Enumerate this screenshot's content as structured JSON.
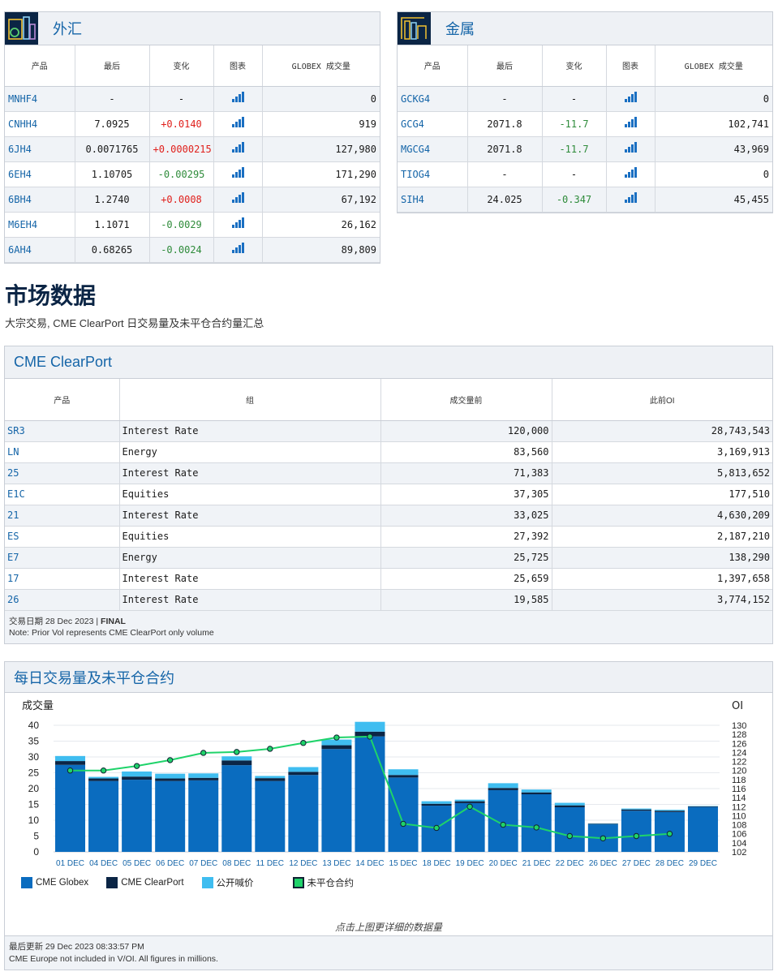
{
  "fx": {
    "title": "外汇",
    "columns": [
      "产品",
      "最后",
      "变化",
      "图表",
      "GLOBEX 成交量"
    ],
    "rows": [
      {
        "symbol": "MNHF4",
        "last": "-",
        "change": "-",
        "dir": "none",
        "volume": "0"
      },
      {
        "symbol": "CNHH4",
        "last": "7.0925",
        "change": "+0.0140",
        "dir": "up",
        "volume": "919"
      },
      {
        "symbol": "6JH4",
        "last": "0.0071765",
        "change": "+0.0000215",
        "dir": "up",
        "volume": "127,980"
      },
      {
        "symbol": "6EH4",
        "last": "1.10705",
        "change": "-0.00295",
        "dir": "down",
        "volume": "171,290"
      },
      {
        "symbol": "6BH4",
        "last": "1.2740",
        "change": "+0.0008",
        "dir": "up",
        "volume": "67,192"
      },
      {
        "symbol": "M6EH4",
        "last": "1.1071",
        "change": "-0.0029",
        "dir": "down",
        "volume": "26,162"
      },
      {
        "symbol": "6AH4",
        "last": "0.68265",
        "change": "-0.0024",
        "dir": "down",
        "volume": "89,809"
      }
    ]
  },
  "metals": {
    "title": "金属",
    "columns": [
      "产品",
      "最后",
      "变化",
      "图表",
      "GLOBEX 成交量"
    ],
    "rows": [
      {
        "symbol": "GCKG4",
        "last": "-",
        "change": "-",
        "dir": "none",
        "volume": "0"
      },
      {
        "symbol": "GCG4",
        "last": "2071.8",
        "change": "-11.7",
        "dir": "down",
        "volume": "102,741"
      },
      {
        "symbol": "MGCG4",
        "last": "2071.8",
        "change": "-11.7",
        "dir": "down",
        "volume": "43,969"
      },
      {
        "symbol": "TIOG4",
        "last": "-",
        "change": "-",
        "dir": "none",
        "volume": "0"
      },
      {
        "symbol": "SIH4",
        "last": "24.025",
        "change": "-0.347",
        "dir": "down",
        "volume": "45,455"
      }
    ]
  },
  "market": {
    "title": "市场数据",
    "subtitle": "大宗交易, CME ClearPort 日交易量及未平仓合约量汇总"
  },
  "clearport": {
    "title": "CME ClearPort",
    "columns": [
      "产品",
      "组",
      "成交量前",
      "此前OI"
    ],
    "rows": [
      {
        "symbol": "SR3",
        "group": "Interest Rate",
        "volume": "120,000",
        "oi": "28,743,543"
      },
      {
        "symbol": "LN",
        "group": "Energy",
        "volume": "83,560",
        "oi": "3,169,913"
      },
      {
        "symbol": "25",
        "group": "Interest Rate",
        "volume": "71,383",
        "oi": "5,813,652"
      },
      {
        "symbol": "E1C",
        "group": "Equities",
        "volume": "37,305",
        "oi": "177,510"
      },
      {
        "symbol": "21",
        "group": "Interest Rate",
        "volume": "33,025",
        "oi": "4,630,209"
      },
      {
        "symbol": "ES",
        "group": "Equities",
        "volume": "27,392",
        "oi": "2,187,210"
      },
      {
        "symbol": "E7",
        "group": "Energy",
        "volume": "25,725",
        "oi": "138,290"
      },
      {
        "symbol": "17",
        "group": "Interest Rate",
        "volume": "25,659",
        "oi": "1,397,658"
      },
      {
        "symbol": "26",
        "group": "Interest Rate",
        "volume": "19,585",
        "oi": "3,774,152"
      }
    ],
    "trade_date_label": "交易日期 28 Dec 2023 | ",
    "trade_status": "FINAL",
    "note": "Note: Prior Vol represents CME ClearPort only volume"
  },
  "volume_chart": {
    "title": "每日交易量及未平仓合约",
    "hint": "点击上图更详细的数据量",
    "updated": "最后更新 29 Dec 2023 08:33:57 PM",
    "footnote": "CME Europe not included in V/OI. All figures in millions."
  },
  "colors": {
    "globex": "#0a6cbf",
    "clearport": "#0b2545",
    "openoutcry": "#3fbdf0",
    "oi_line": "#1fd36a",
    "link": "#1565a8"
  },
  "chart_data": {
    "type": "bar",
    "ylabel": "成交量",
    "y2label": "OI",
    "ylim": [
      0,
      40
    ],
    "yticks": [
      0,
      5,
      10,
      15,
      20,
      25,
      30,
      35,
      40
    ],
    "y2lim": [
      102,
      130
    ],
    "y2ticks": [
      102,
      104,
      106,
      108,
      110,
      112,
      114,
      116,
      118,
      120,
      122,
      124,
      126,
      128,
      130
    ],
    "categories": [
      "01 DEC",
      "04 DEC",
      "05 DEC",
      "06 DEC",
      "07 DEC",
      "08 DEC",
      "11 DEC",
      "12 DEC",
      "13 DEC",
      "14 DEC",
      "15 DEC",
      "18 DEC",
      "19 DEC",
      "20 DEC",
      "21 DEC",
      "22 DEC",
      "26 DEC",
      "27 DEC",
      "28 DEC",
      "29 DEC"
    ],
    "legend": [
      "CME Globex",
      "CME ClearPort",
      "公开喊价",
      "未平仓合约"
    ],
    "series": [
      {
        "name": "CME Globex",
        "values": [
          27.5,
          22.4,
          22.8,
          22.4,
          22.6,
          27.4,
          22.4,
          24.3,
          32.5,
          36.5,
          23.5,
          14.6,
          15.4,
          19.5,
          18.2,
          14.1,
          8.7,
          13.0,
          12.6,
          14.2
        ]
      },
      {
        "name": "CME ClearPort",
        "values": [
          1.2,
          0.8,
          1.0,
          0.8,
          0.8,
          1.5,
          0.9,
          1.0,
          1.2,
          1.5,
          0.8,
          0.6,
          0.6,
          0.7,
          0.6,
          0.6,
          0.2,
          0.4,
          0.4,
          0.2
        ]
      },
      {
        "name": "公开喊价",
        "values": [
          1.6,
          0.5,
          1.6,
          1.5,
          1.4,
          1.3,
          0.7,
          1.5,
          1.8,
          3.1,
          1.8,
          0.8,
          0.5,
          1.5,
          0.9,
          0.8,
          0.1,
          0.3,
          0.3,
          0.1
        ]
      },
      {
        "name": "未平仓合约",
        "values": [
          120.0,
          120.0,
          121.0,
          122.3,
          123.9,
          124.1,
          124.8,
          126.1,
          127.3,
          127.5,
          108.2,
          107.3,
          112.0,
          108.0,
          107.4,
          105.5,
          105.0,
          105.5,
          106.0,
          null
        ]
      }
    ]
  }
}
